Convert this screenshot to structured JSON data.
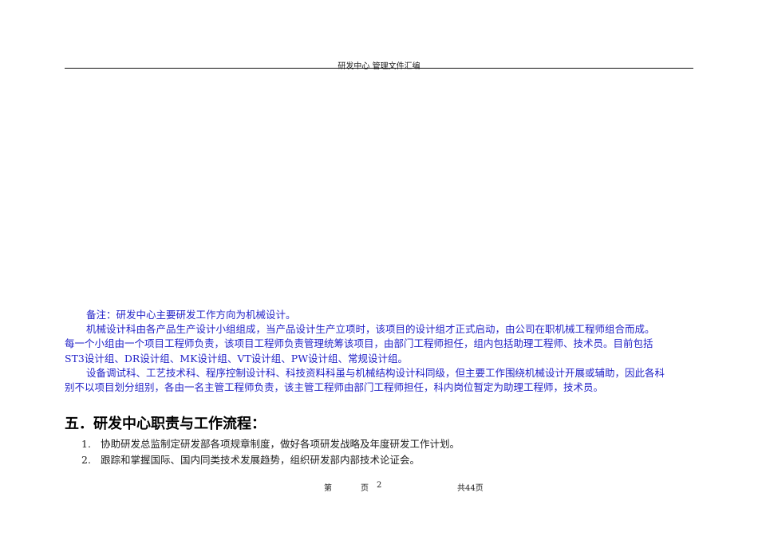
{
  "header": {
    "title": "研发中心 管理文件汇编"
  },
  "notes": {
    "line1": "备注：研发中心主要研发工作方向为机械设计。",
    "para2_line1": "机械设计科由各产品生产设计小组组成，当产品设计生产立项时，该项目的设计组才正式启动，由公司在职机械工程师组合而成。",
    "para2_line2": "每一个小组由一个项目工程师负责，该项目工程师负责管理统筹该项目，由部门工程师担任，组内包括助理工程师、技术员。目前包括",
    "para2_line3": "ST3设计组、DR设计组、MK设计组、VT设计组、PW设计组、常规设计组。",
    "para3_line1": "设备调试科、工艺技术科、程序控制设计科、科技资料科虽与机械结构设计科同级，但主要工作围绕机械设计开展或辅助，因此各科",
    "para3_line2": "别不以项目划分组别，各由一名主管工程师负责，该主管工程师由部门工程师担任，科内岗位暂定为助理工程师，技术员。"
  },
  "section": {
    "heading": "五．研发中心职责与工作流程：",
    "items": [
      {
        "num": "1.",
        "text": "协助研发总监制定研发部各项规章制度，做好各项研发战略及年度研发工作计划。"
      },
      {
        "num": "2.",
        "text": "跟踪和掌握国际、国内同类技术发展趋势，组织研发部内部技术论证会。"
      }
    ]
  },
  "footer": {
    "page_label": "第",
    "page_unit": "页",
    "page_num": "2",
    "total": "共44页"
  }
}
